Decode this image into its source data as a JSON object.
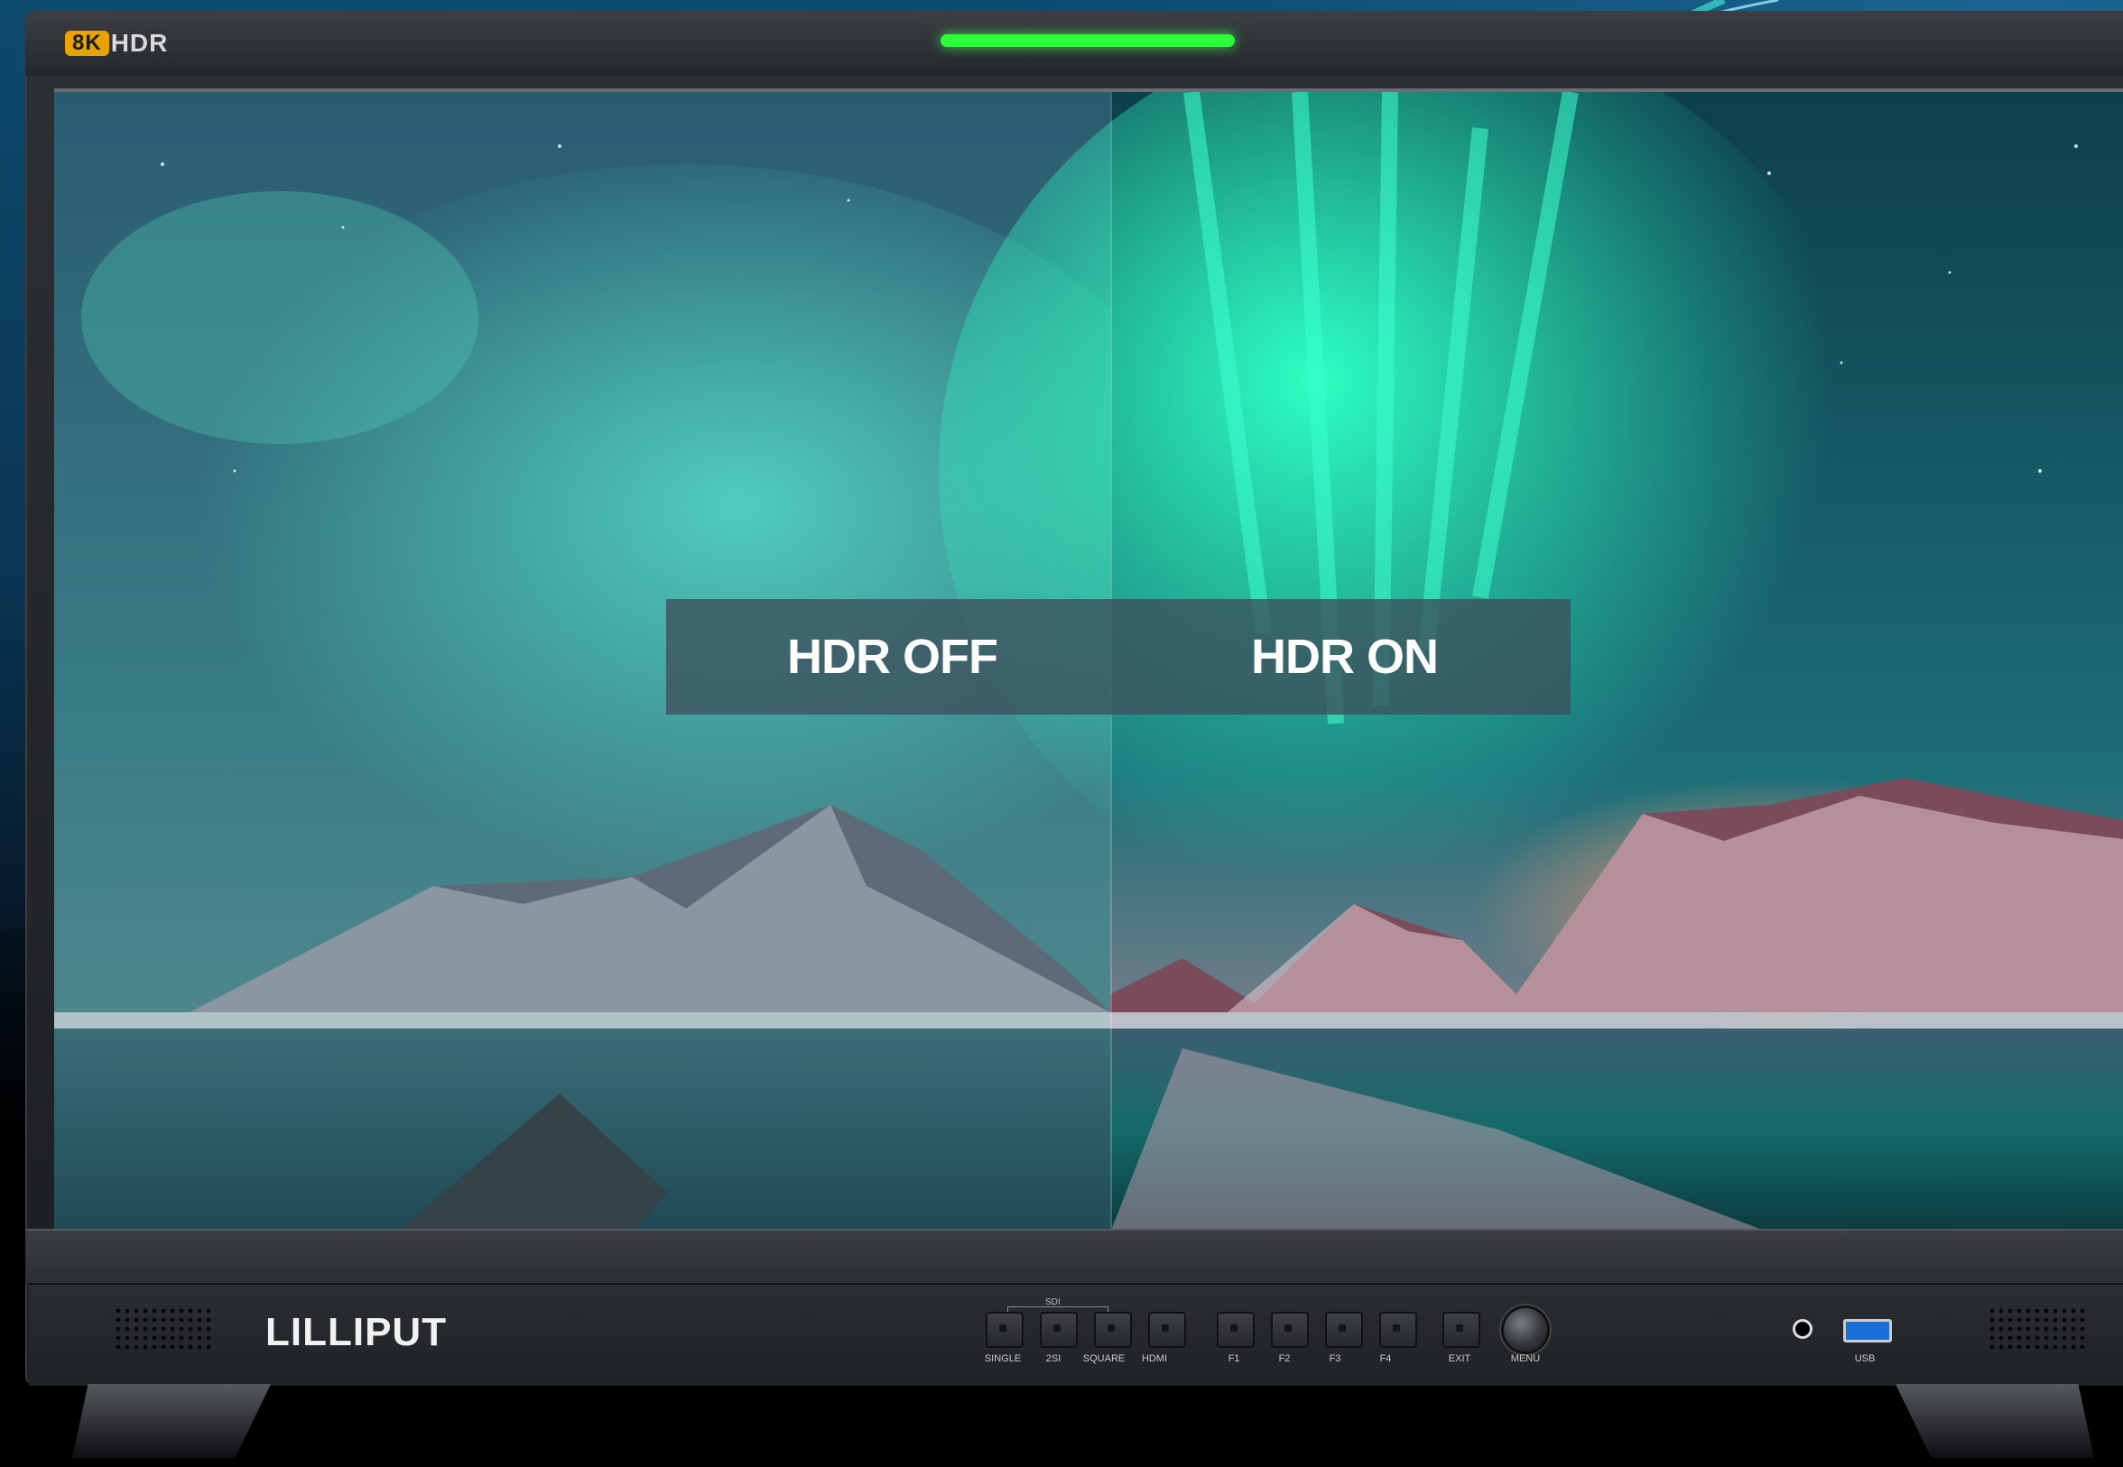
{
  "bezel": {
    "badge_8k": "8K",
    "badge_hdr": "HDR"
  },
  "comparison": {
    "left_label": "HDR OFF",
    "right_label": "HDR ON"
  },
  "panel": {
    "brand": "LILLIPUT",
    "sdi_group_label": "SDI",
    "buttons": [
      {
        "label": "SINGLE"
      },
      {
        "label": "2SI"
      },
      {
        "label": "SQUARE"
      },
      {
        "label": "HDMI"
      },
      {
        "label": "F1"
      },
      {
        "label": "F2"
      },
      {
        "label": "F3"
      },
      {
        "label": "F4"
      },
      {
        "label": "EXIT"
      }
    ],
    "knob_label": "MENU",
    "usb_label": "USB"
  },
  "colors": {
    "tally": "#2cff3a",
    "badge": "#e8a300",
    "usb_port": "#1b6fd8"
  }
}
